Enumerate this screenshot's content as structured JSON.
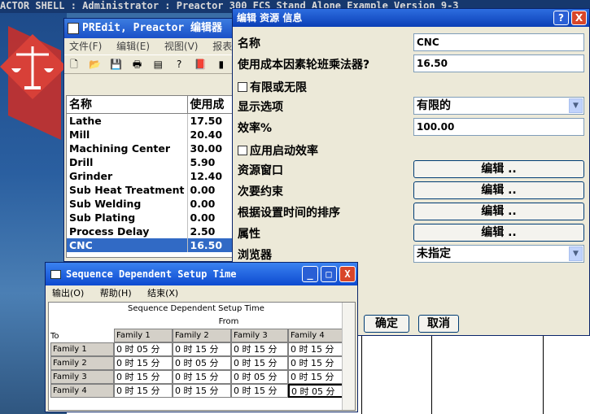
{
  "shell": {
    "title": "ACTOR SHELL : Administrator : Preactor 300 FCS Stand Alone Example Version 9-3"
  },
  "predit": {
    "title": "PREdit, Preactor 编辑器",
    "menu": [
      "文件(F)",
      "编辑(E)",
      "视图(V)",
      "报表"
    ],
    "col_name": "名称",
    "col_value": "使用成",
    "rows": [
      {
        "name": "Lathe",
        "value": "17.50"
      },
      {
        "name": "Mill",
        "value": "20.40"
      },
      {
        "name": "Machining Center",
        "value": "30.00"
      },
      {
        "name": "Drill",
        "value": "5.90"
      },
      {
        "name": "Grinder",
        "value": "12.40"
      },
      {
        "name": "Sub Heat Treatment",
        "value": "0.00"
      },
      {
        "name": "Sub Welding",
        "value": "0.00"
      },
      {
        "name": "Sub Plating",
        "value": "0.00"
      },
      {
        "name": "Process Delay",
        "value": "2.50"
      },
      {
        "name": "CNC",
        "value": "16.50"
      }
    ]
  },
  "dialog": {
    "title": "编辑 资源 信息",
    "help_btn": "?",
    "close_btn": "X",
    "name_label": "名称",
    "name_value": "CNC",
    "cost_label": "使用成本因素轮班乘法器?",
    "cost_value": "16.50",
    "finite_label": "有限或无限",
    "display_label": "显示选项",
    "display_value": "有限的",
    "eff_label": "效率%",
    "eff_value": "100.00",
    "start_eff_label": "应用启动效率",
    "window_label": "资源窗口",
    "secondary_label": "次要约束",
    "sort_label": "根据设置时间的排序",
    "attr_label": "属性",
    "browser_label": "浏览器",
    "browser_value": "未指定",
    "edit_label": "编辑 ..",
    "ok": "确定",
    "cancel": "取消"
  },
  "seq": {
    "title": "Sequence Dependent Setup Time",
    "menu": [
      "输出(O)",
      "帮助(H)",
      "结束(X)"
    ],
    "caption": "Sequence Dependent Setup Time",
    "from_label": "From",
    "to_label": "To",
    "cols": [
      "Family 1",
      "Family 2",
      "Family 3",
      "Family 4"
    ],
    "rows": [
      {
        "label": "Family 1",
        "cells": [
          "0 时 05 分",
          "0 时 15 分",
          "0 时 15 分",
          "0 时 15 分"
        ]
      },
      {
        "label": "Family 2",
        "cells": [
          "0 时 15 分",
          "0 时 05 分",
          "0 时 15 分",
          "0 时 15 分"
        ]
      },
      {
        "label": "Family 3",
        "cells": [
          "0 时 15 分",
          "0 时 15 分",
          "0 时 05 分",
          "0 时 15 分"
        ]
      },
      {
        "label": "Family 4",
        "cells": [
          "0 时 15 分",
          "0 时 15 分",
          "0 时 15 分",
          "0 时 05 分"
        ]
      }
    ],
    "minimize": "_",
    "maximize": "□",
    "close": "X"
  }
}
